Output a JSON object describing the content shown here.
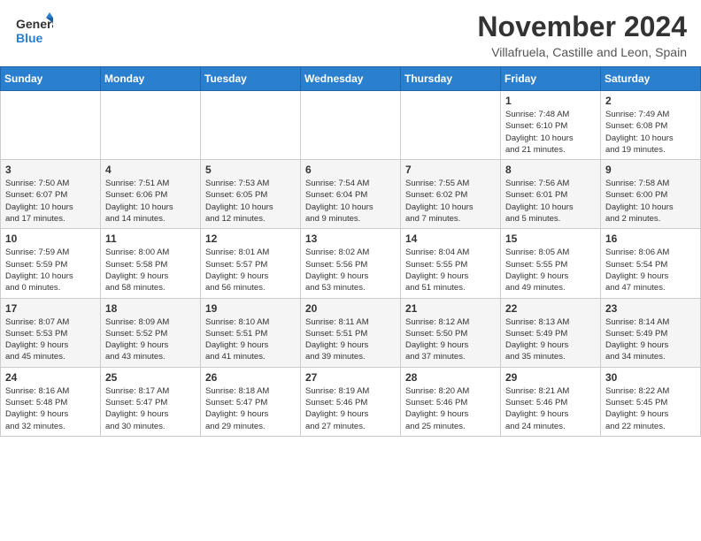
{
  "header": {
    "logo_line1": "General",
    "logo_line2": "Blue",
    "month_title": "November 2024",
    "location": "Villafruela, Castille and Leon, Spain"
  },
  "weekdays": [
    "Sunday",
    "Monday",
    "Tuesday",
    "Wednesday",
    "Thursday",
    "Friday",
    "Saturday"
  ],
  "weeks": [
    [
      {
        "day": "",
        "info": ""
      },
      {
        "day": "",
        "info": ""
      },
      {
        "day": "",
        "info": ""
      },
      {
        "day": "",
        "info": ""
      },
      {
        "day": "",
        "info": ""
      },
      {
        "day": "1",
        "info": "Sunrise: 7:48 AM\nSunset: 6:10 PM\nDaylight: 10 hours\nand 21 minutes."
      },
      {
        "day": "2",
        "info": "Sunrise: 7:49 AM\nSunset: 6:08 PM\nDaylight: 10 hours\nand 19 minutes."
      }
    ],
    [
      {
        "day": "3",
        "info": "Sunrise: 7:50 AM\nSunset: 6:07 PM\nDaylight: 10 hours\nand 17 minutes."
      },
      {
        "day": "4",
        "info": "Sunrise: 7:51 AM\nSunset: 6:06 PM\nDaylight: 10 hours\nand 14 minutes."
      },
      {
        "day": "5",
        "info": "Sunrise: 7:53 AM\nSunset: 6:05 PM\nDaylight: 10 hours\nand 12 minutes."
      },
      {
        "day": "6",
        "info": "Sunrise: 7:54 AM\nSunset: 6:04 PM\nDaylight: 10 hours\nand 9 minutes."
      },
      {
        "day": "7",
        "info": "Sunrise: 7:55 AM\nSunset: 6:02 PM\nDaylight: 10 hours\nand 7 minutes."
      },
      {
        "day": "8",
        "info": "Sunrise: 7:56 AM\nSunset: 6:01 PM\nDaylight: 10 hours\nand 5 minutes."
      },
      {
        "day": "9",
        "info": "Sunrise: 7:58 AM\nSunset: 6:00 PM\nDaylight: 10 hours\nand 2 minutes."
      }
    ],
    [
      {
        "day": "10",
        "info": "Sunrise: 7:59 AM\nSunset: 5:59 PM\nDaylight: 10 hours\nand 0 minutes."
      },
      {
        "day": "11",
        "info": "Sunrise: 8:00 AM\nSunset: 5:58 PM\nDaylight: 9 hours\nand 58 minutes."
      },
      {
        "day": "12",
        "info": "Sunrise: 8:01 AM\nSunset: 5:57 PM\nDaylight: 9 hours\nand 56 minutes."
      },
      {
        "day": "13",
        "info": "Sunrise: 8:02 AM\nSunset: 5:56 PM\nDaylight: 9 hours\nand 53 minutes."
      },
      {
        "day": "14",
        "info": "Sunrise: 8:04 AM\nSunset: 5:55 PM\nDaylight: 9 hours\nand 51 minutes."
      },
      {
        "day": "15",
        "info": "Sunrise: 8:05 AM\nSunset: 5:55 PM\nDaylight: 9 hours\nand 49 minutes."
      },
      {
        "day": "16",
        "info": "Sunrise: 8:06 AM\nSunset: 5:54 PM\nDaylight: 9 hours\nand 47 minutes."
      }
    ],
    [
      {
        "day": "17",
        "info": "Sunrise: 8:07 AM\nSunset: 5:53 PM\nDaylight: 9 hours\nand 45 minutes."
      },
      {
        "day": "18",
        "info": "Sunrise: 8:09 AM\nSunset: 5:52 PM\nDaylight: 9 hours\nand 43 minutes."
      },
      {
        "day": "19",
        "info": "Sunrise: 8:10 AM\nSunset: 5:51 PM\nDaylight: 9 hours\nand 41 minutes."
      },
      {
        "day": "20",
        "info": "Sunrise: 8:11 AM\nSunset: 5:51 PM\nDaylight: 9 hours\nand 39 minutes."
      },
      {
        "day": "21",
        "info": "Sunrise: 8:12 AM\nSunset: 5:50 PM\nDaylight: 9 hours\nand 37 minutes."
      },
      {
        "day": "22",
        "info": "Sunrise: 8:13 AM\nSunset: 5:49 PM\nDaylight: 9 hours\nand 35 minutes."
      },
      {
        "day": "23",
        "info": "Sunrise: 8:14 AM\nSunset: 5:49 PM\nDaylight: 9 hours\nand 34 minutes."
      }
    ],
    [
      {
        "day": "24",
        "info": "Sunrise: 8:16 AM\nSunset: 5:48 PM\nDaylight: 9 hours\nand 32 minutes."
      },
      {
        "day": "25",
        "info": "Sunrise: 8:17 AM\nSunset: 5:47 PM\nDaylight: 9 hours\nand 30 minutes."
      },
      {
        "day": "26",
        "info": "Sunrise: 8:18 AM\nSunset: 5:47 PM\nDaylight: 9 hours\nand 29 minutes."
      },
      {
        "day": "27",
        "info": "Sunrise: 8:19 AM\nSunset: 5:46 PM\nDaylight: 9 hours\nand 27 minutes."
      },
      {
        "day": "28",
        "info": "Sunrise: 8:20 AM\nSunset: 5:46 PM\nDaylight: 9 hours\nand 25 minutes."
      },
      {
        "day": "29",
        "info": "Sunrise: 8:21 AM\nSunset: 5:46 PM\nDaylight: 9 hours\nand 24 minutes."
      },
      {
        "day": "30",
        "info": "Sunrise: 8:22 AM\nSunset: 5:45 PM\nDaylight: 9 hours\nand 22 minutes."
      }
    ]
  ]
}
